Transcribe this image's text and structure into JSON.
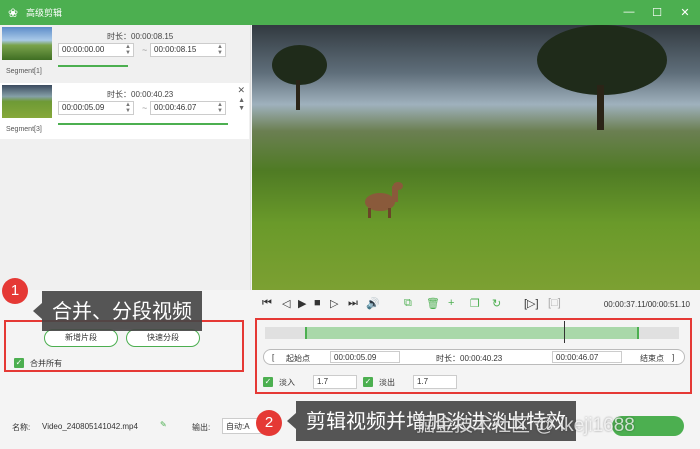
{
  "window": {
    "title": "高级剪辑"
  },
  "segments": [
    {
      "label": "Segment[1]",
      "duration": "时长：00:00:08.15",
      "start": "00:00:00.00",
      "end": "00:00:08.15"
    },
    {
      "label": "Segment[3]",
      "duration": "时长：00:00:40.23",
      "start": "00:00:05.09",
      "end": "00:00:46.07"
    }
  ],
  "player": {
    "time_readout": "00:00:37.11/00:00:51.10"
  },
  "trim": {
    "start_label": "起始点",
    "start_value": "00:00:05.09",
    "duration": "时长：00:00:40.23",
    "end_value": "00:00:46.07",
    "end_label": "结束点",
    "fade_in_label": "淡入",
    "fade_in_value": "1.7",
    "fade_out_label": "淡出",
    "fade_out_value": "1.7"
  },
  "left_buttons": {
    "new_segment": "新增片段",
    "quick_split": "快速分段",
    "merge_all": "合并所有"
  },
  "bottom": {
    "name_label": "名称:",
    "filename": "Video_240805141042.mp4",
    "output_label": "输出:",
    "output_value": "自动:A"
  },
  "annotations": [
    {
      "num": "1",
      "text": "合并、分段视频"
    },
    {
      "num": "2",
      "text": "剪辑视频并增加淡进淡出特效"
    }
  ],
  "watermark": "掘金技术社区 @ ikeji1688",
  "colors": {
    "accent": "#4caf50",
    "annotation": "#e53935"
  }
}
